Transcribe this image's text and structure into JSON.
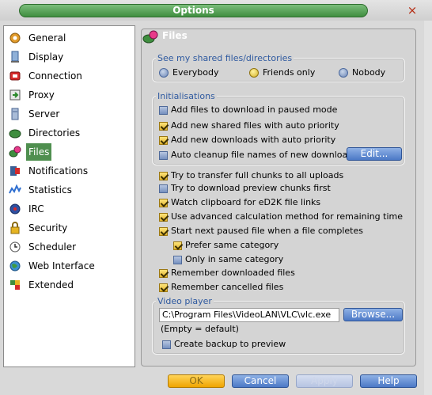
{
  "window": {
    "title": "Options",
    "close_glyph": "×"
  },
  "sidebar": {
    "items": [
      {
        "label": "General",
        "icon": "gear-icon"
      },
      {
        "label": "Display",
        "icon": "display-icon"
      },
      {
        "label": "Connection",
        "icon": "connection-icon"
      },
      {
        "label": "Proxy",
        "icon": "proxy-icon"
      },
      {
        "label": "Server",
        "icon": "server-icon"
      },
      {
        "label": "Directories",
        "icon": "folder-icon"
      },
      {
        "label": "Files",
        "icon": "files-icon",
        "selected": true
      },
      {
        "label": "Notifications",
        "icon": "notifications-icon"
      },
      {
        "label": "Statistics",
        "icon": "statistics-icon"
      },
      {
        "label": "IRC",
        "icon": "irc-icon"
      },
      {
        "label": "Security",
        "icon": "lock-icon"
      },
      {
        "label": "Scheduler",
        "icon": "clock-icon"
      },
      {
        "label": "Web Interface",
        "icon": "globe-icon"
      },
      {
        "label": "Extended",
        "icon": "extended-icon"
      }
    ]
  },
  "panel": {
    "title": "Files",
    "shared": {
      "title": "See my shared files/directories",
      "options": [
        "Everybody",
        "Friends only",
        "Nobody"
      ],
      "selected": "Friends only"
    },
    "init": {
      "title": "Initialisations",
      "options": [
        {
          "label": "Add files to download in paused mode",
          "checked": false
        },
        {
          "label": "Add new shared files with auto priority",
          "checked": true
        },
        {
          "label": "Add new downloads with auto priority",
          "checked": true
        },
        {
          "label": "Auto cleanup file names of new downloads",
          "checked": false
        }
      ],
      "edit_label": "Edit..."
    },
    "options": [
      {
        "label": "Try to transfer full chunks to all uploads",
        "checked": true
      },
      {
        "label": "Try to download preview chunks first",
        "checked": false
      },
      {
        "label": "Watch clipboard for eD2K file links",
        "checked": true
      },
      {
        "label": "Use advanced calculation method for remaining time",
        "checked": true
      },
      {
        "label": "Start next paused file when a file completes",
        "checked": true
      },
      {
        "label": "Prefer same category",
        "checked": true
      },
      {
        "label": "Only in same category",
        "checked": false
      },
      {
        "label": "Remember downloaded files",
        "checked": true
      },
      {
        "label": "Remember cancelled files",
        "checked": true
      }
    ],
    "video": {
      "title": "Video player",
      "path": "C:\\Program Files\\VideoLAN\\VLC\\vlc.exe",
      "hint": "(Empty = default)",
      "browse_label": "Browse...",
      "backup_label": "Create backup to preview",
      "backup_checked": false
    }
  },
  "buttons": {
    "ok": "OK",
    "cancel": "Cancel",
    "apply": "Apply",
    "help": "Help"
  },
  "colors": {
    "title_green": "#4c9a4c",
    "accent_blue": "#4c79c6",
    "ok_yellow": "#f0a400",
    "group_title": "#2f5aa0"
  }
}
